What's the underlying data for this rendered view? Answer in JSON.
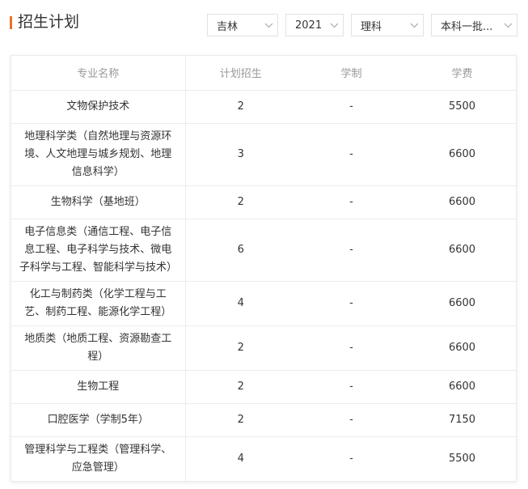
{
  "header": {
    "title": "招生计划"
  },
  "filters": {
    "province": "吉林",
    "year": "2021",
    "subject": "理科",
    "batch": "本科一批..."
  },
  "table": {
    "columns": [
      "专业名称",
      "计划招生",
      "学制",
      "学费"
    ],
    "rows": [
      {
        "major": "文物保护技术",
        "plan": "2",
        "duration": "-",
        "fee": "5500"
      },
      {
        "major": "地理科学类（自然地理与资源环境、人文地理与城乡规划、地理信息科学）",
        "plan": "3",
        "duration": "-",
        "fee": "6600"
      },
      {
        "major": "生物科学（基地班）",
        "plan": "2",
        "duration": "-",
        "fee": "6600"
      },
      {
        "major": "电子信息类（通信工程、电子信息工程、电子科学与技术、微电子科学与工程、智能科学与技术）",
        "plan": "6",
        "duration": "-",
        "fee": "6600"
      },
      {
        "major": "化工与制药类（化学工程与工艺、制药工程、能源化学工程）",
        "plan": "4",
        "duration": "-",
        "fee": "6600"
      },
      {
        "major": "地质类（地质工程、资源勘查工程）",
        "plan": "2",
        "duration": "-",
        "fee": "6600"
      },
      {
        "major": "生物工程",
        "plan": "2",
        "duration": "-",
        "fee": "6600"
      },
      {
        "major": "口腔医学（学制5年）",
        "plan": "2",
        "duration": "-",
        "fee": "7150"
      },
      {
        "major": "管理科学与工程类（管理科学、应急管理）",
        "plan": "4",
        "duration": "-",
        "fee": "5500"
      }
    ]
  },
  "colors": {
    "accent": "#e8722a",
    "border": "#ececec",
    "header_text": "#999999"
  }
}
